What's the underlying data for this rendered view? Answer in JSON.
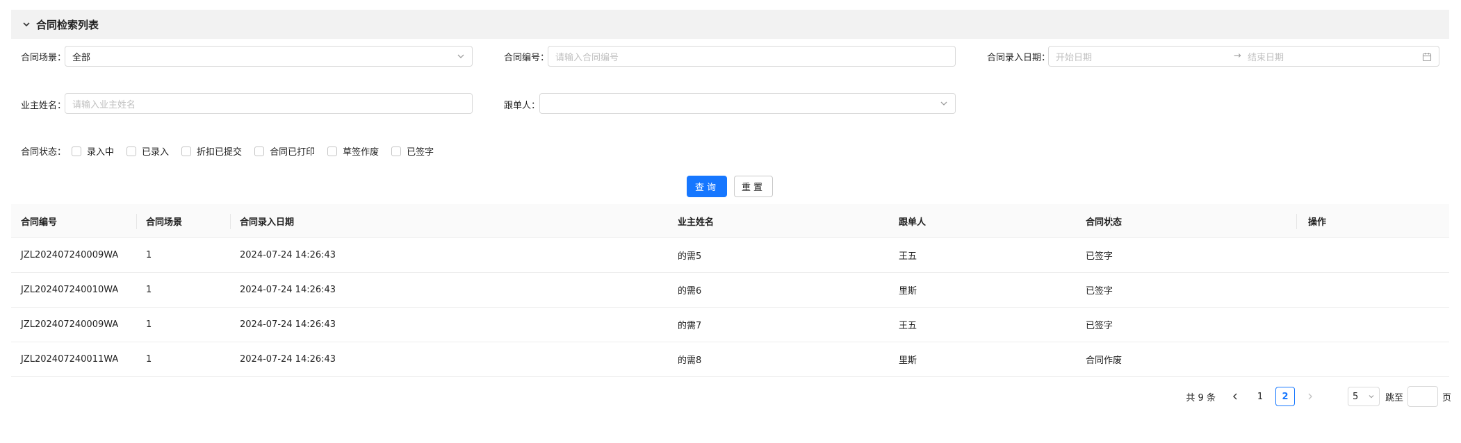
{
  "panel": {
    "title": "合同检索列表"
  },
  "form": {
    "scene_label": "合同场景：",
    "scene_value": "全部",
    "number_label": "合同编号：",
    "number_placeholder": "请输入合同编号",
    "date_label": "合同录入日期：",
    "date_start_placeholder": "开始日期",
    "date_end_placeholder": "结束日期",
    "date_separator": "→",
    "owner_label": "业主姓名：",
    "owner_placeholder": "请输入业主姓名",
    "follower_label": "跟单人：",
    "status_label": "合同状态：",
    "status_options": [
      "录入中",
      "已录入",
      "折扣已提交",
      "合同已打印",
      "草签作废",
      "已签字"
    ]
  },
  "buttons": {
    "search": "查询",
    "reset": "重置"
  },
  "table": {
    "columns": [
      "合同编号",
      "合同场景",
      "合同录入日期",
      "业主姓名",
      "跟单人",
      "合同状态",
      "操作"
    ],
    "rows": [
      [
        "JZL202407240009WA",
        "1",
        "2024-07-24 14:26:43",
        "的需5",
        "王五",
        "已签字",
        ""
      ],
      [
        "JZL202407240010WA",
        "1",
        "2024-07-24 14:26:43",
        "的需6",
        "里斯",
        "已签字",
        ""
      ],
      [
        "JZL202407240009WA",
        "1",
        "2024-07-24 14:26:43",
        "的需7",
        "王五",
        "已签字",
        ""
      ],
      [
        "JZL202407240011WA",
        "1",
        "2024-07-24 14:26:43",
        "的需8",
        "里斯",
        "合同作废",
        ""
      ]
    ]
  },
  "pagination": {
    "total_text": "共 9 条",
    "pages": [
      "1",
      "2"
    ],
    "current_page": "2",
    "page_size": "5",
    "jump_label": "跳至",
    "page_suffix": "页"
  },
  "colors": {
    "primary": "#1677ff",
    "header_bg": "#f2f2f2",
    "table_head_bg": "#fafafa"
  }
}
